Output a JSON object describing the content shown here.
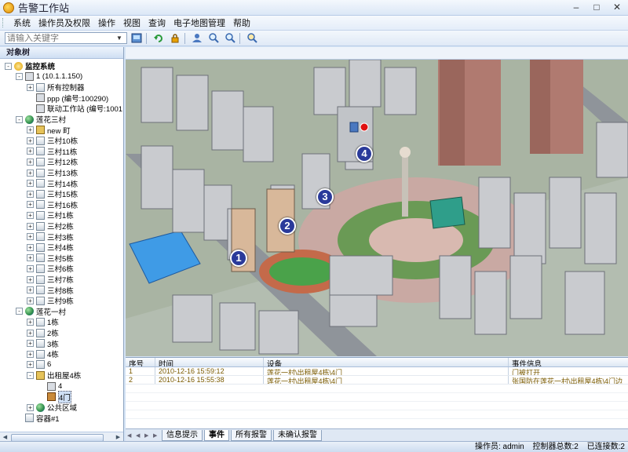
{
  "window": {
    "title": "告警工作站"
  },
  "menu": [
    "系统",
    "操作员及权限",
    "操作",
    "视图",
    "查询",
    "电子地图管理",
    "帮助"
  ],
  "toolbar": {
    "search_placeholder": "请输入关键字",
    "buttons": [
      "map-icon",
      "refresh-icon",
      "lock-icon",
      "user-icon",
      "zoom-in-icon",
      "zoom-out-icon",
      "locate-icon"
    ]
  },
  "left_panel": {
    "title": "对象树",
    "tree": [
      {
        "label": "监控系统",
        "depth": 0,
        "icon": "root",
        "exp": "-"
      },
      {
        "label": "1 (10.1.1.150)",
        "depth": 1,
        "icon": "pc",
        "exp": "-"
      },
      {
        "label": "所有控制器",
        "depth": 2,
        "icon": "bld",
        "exp": "+"
      },
      {
        "label": "ppp (编号:100290)",
        "depth": 2,
        "icon": "pc",
        "exp": ""
      },
      {
        "label": "联动工作站 (编号:1001",
        "depth": 2,
        "icon": "pc",
        "exp": ""
      },
      {
        "label": "莲花三村",
        "depth": 1,
        "icon": "globe",
        "exp": "-"
      },
      {
        "label": "new 町",
        "depth": 2,
        "icon": "house",
        "exp": "+"
      },
      {
        "label": "三村10栋",
        "depth": 2,
        "icon": "bld",
        "exp": "+"
      },
      {
        "label": "三村11栋",
        "depth": 2,
        "icon": "bld",
        "exp": "+"
      },
      {
        "label": "三村12栋",
        "depth": 2,
        "icon": "bld",
        "exp": "+"
      },
      {
        "label": "三村13栋",
        "depth": 2,
        "icon": "bld",
        "exp": "+"
      },
      {
        "label": "三村14栋",
        "depth": 2,
        "icon": "bld",
        "exp": "+"
      },
      {
        "label": "三村15栋",
        "depth": 2,
        "icon": "bld",
        "exp": "+"
      },
      {
        "label": "三村16栋",
        "depth": 2,
        "icon": "bld",
        "exp": "+"
      },
      {
        "label": "三村1栋",
        "depth": 2,
        "icon": "bld",
        "exp": "+"
      },
      {
        "label": "三村2栋",
        "depth": 2,
        "icon": "bld",
        "exp": "+"
      },
      {
        "label": "三村3栋",
        "depth": 2,
        "icon": "bld",
        "exp": "+"
      },
      {
        "label": "三村4栋",
        "depth": 2,
        "icon": "bld",
        "exp": "+"
      },
      {
        "label": "三村5栋",
        "depth": 2,
        "icon": "bld",
        "exp": "+"
      },
      {
        "label": "三村6栋",
        "depth": 2,
        "icon": "bld",
        "exp": "+"
      },
      {
        "label": "三村7栋",
        "depth": 2,
        "icon": "bld",
        "exp": "+"
      },
      {
        "label": "三村8栋",
        "depth": 2,
        "icon": "bld",
        "exp": "+"
      },
      {
        "label": "三村9栋",
        "depth": 2,
        "icon": "bld",
        "exp": "+"
      },
      {
        "label": "莲花一村",
        "depth": 1,
        "icon": "globe",
        "exp": "-"
      },
      {
        "label": "1栋",
        "depth": 2,
        "icon": "bld",
        "exp": "+"
      },
      {
        "label": "2栋",
        "depth": 2,
        "icon": "bld",
        "exp": "+"
      },
      {
        "label": "3栋",
        "depth": 2,
        "icon": "bld",
        "exp": "+"
      },
      {
        "label": "4栋",
        "depth": 2,
        "icon": "bld",
        "exp": "+"
      },
      {
        "label": "6",
        "depth": 2,
        "icon": "bld",
        "exp": "+"
      },
      {
        "label": "出租屋4栋",
        "depth": 2,
        "icon": "house",
        "exp": "-"
      },
      {
        "label": "4",
        "depth": 3,
        "icon": "pc",
        "exp": ""
      },
      {
        "label": "4门",
        "depth": 3,
        "icon": "door",
        "exp": ""
      },
      {
        "label": "公共区域",
        "depth": 2,
        "icon": "globe",
        "exp": "+"
      },
      {
        "label": "容器#1",
        "depth": 1,
        "icon": "bld",
        "exp": ""
      }
    ]
  },
  "map": {
    "markers": [
      "1",
      "2",
      "3",
      "4"
    ]
  },
  "events": {
    "columns": [
      "序号",
      "时间",
      "设备",
      "事件信息"
    ],
    "rows": [
      [
        "1",
        "2010-12-16  15:59:12",
        "莲花一村\\出租屋4栋\\4门",
        "门被打开"
      ],
      [
        "2",
        "2010-12-16  15:55:38",
        "莲花一村\\出租屋4栋\\4门",
        "张国防在莲花一村\\出租屋4栋\\4门边"
      ]
    ]
  },
  "tabs": [
    "信息提示",
    "事件",
    "所有报警",
    "未确认报警"
  ],
  "status": {
    "operator": "操作员: admin",
    "total": "控制器总数:2",
    "connected": "已连接数:2"
  }
}
